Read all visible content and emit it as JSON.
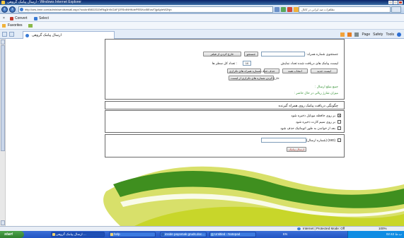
{
  "window": {
    "title": "ارسال پیامک گروهی - Windows Internet Explorer"
  },
  "address_bar": {
    "url": "http://ces-bme.com/admin/sendsmsall.aspx?ocuknEl8D2DZeRkg3rVkGAF|1RSrdNHKdePEBXvd5EvwTljpApIeW2hjn",
    "search_text": "تظاهرات ضد ایرانی در کانال"
  },
  "command_toolbar": {
    "convert_label": "Convert",
    "select_label": "Select"
  },
  "favorites_bar": {
    "favorites_label": "Favorites"
  },
  "tab": {
    "label": "ارسال پیامک گروهی"
  },
  "command_bar": {
    "page_label": "Page",
    "safety_label": "Safety",
    "tools_label": "Tools"
  },
  "form": {
    "phone_search_label": "جستجوی شماره همراه :",
    "search_button": "جستجو",
    "exclude_button": "خارج کردن از فیلتر",
    "list_label": "لیست پیامک های دریافت شده تعداد نمایش",
    "list_count": "10",
    "list_suffix": ": تعداد کل سطر ها",
    "btn_select_list": "لیست جدید",
    "btn_select_all": "انتخاب همه",
    "btn_delete": "حذف",
    "btn_delete_selected": "حذف شماره همراه های تکراری",
    "btn_remove_from_list": "خارج کردن شماره های تکراری از لیست",
    "total_label": "جمع مبلغ ارسال :",
    "balance_label": "میزان شارژ ریالی در حال حاضر :",
    "receive_title": "چگونگی دریافت پیامک روی همراه گیرنده",
    "opt1": "بر روی حافظه موبایل ذخیره شود",
    "opt1_checked": true,
    "opt2": "بر روی سیم کارت ذخیره شود",
    "opt2_checked": false,
    "opt3": "بعد از خواندن به طور اتوماتیک حذف شود",
    "opt3_checked": false,
    "sid_label": "(SID) (شماره ارسال)",
    "send_button": "ارسال پیامک"
  },
  "status_bar": {
    "zone_text": "Internet | Protected Mode: Off",
    "zoom": "100%"
  },
  "taskbar": {
    "start_label": "start",
    "tasks": [
      {
        "label": "ارسال پیامک گروهی ...",
        "active": true
      },
      {
        "label": "help",
        "active": false
      },
      {
        "label": "inside payamak gruds.doc...",
        "active": false
      },
      {
        "label": "Untitled - Notepad",
        "active": false
      }
    ],
    "lang": "EN",
    "clock": "02:42 ب.ظ"
  },
  "colors": {
    "accent_green": "#2f8f2f",
    "decor_dark_green": "#3f8f1f",
    "decor_lime": "#c8d62a"
  }
}
